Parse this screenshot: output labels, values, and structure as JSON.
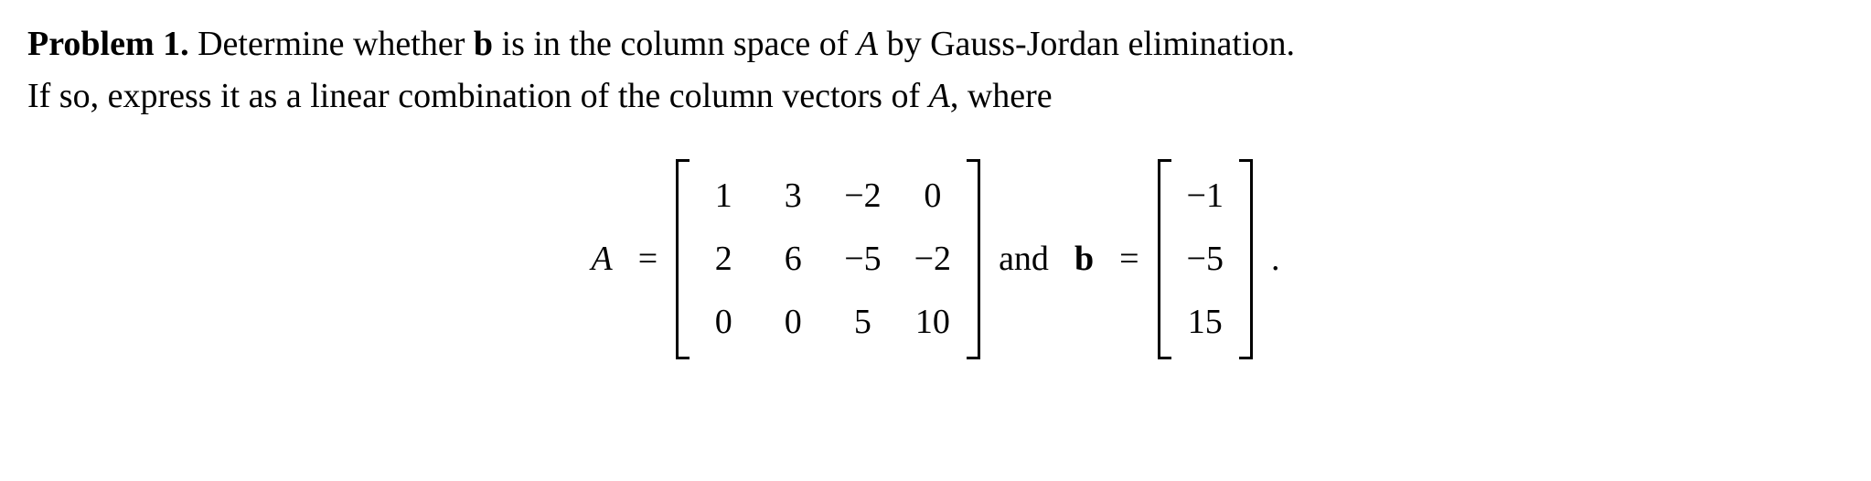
{
  "problem": {
    "label": "Problem 1.",
    "text_part1": " Determine whether ",
    "var_b": "b",
    "text_part2": " is in the column space of ",
    "var_A1": "A",
    "text_part3": " by Gauss-Jordan elimination.",
    "line2_part1": "If so, express it as a linear combination of the column vectors of ",
    "var_A2": "A",
    "line2_part2": ", where"
  },
  "equation": {
    "A_label": "A",
    "equals1": " = ",
    "matrixA": {
      "r0": {
        "c0": "1",
        "c1": "3",
        "c2": "−2",
        "c3": "0"
      },
      "r1": {
        "c0": "2",
        "c1": "6",
        "c2": "−5",
        "c3": "−2"
      },
      "r2": {
        "c0": "0",
        "c1": "0",
        "c2": "5",
        "c3": "10"
      }
    },
    "and_text": "  and ",
    "b_label": "b",
    "equals2": " = ",
    "vectorB": {
      "r0": "−1",
      "r1": "−5",
      "r2": "15"
    },
    "period": " ."
  }
}
